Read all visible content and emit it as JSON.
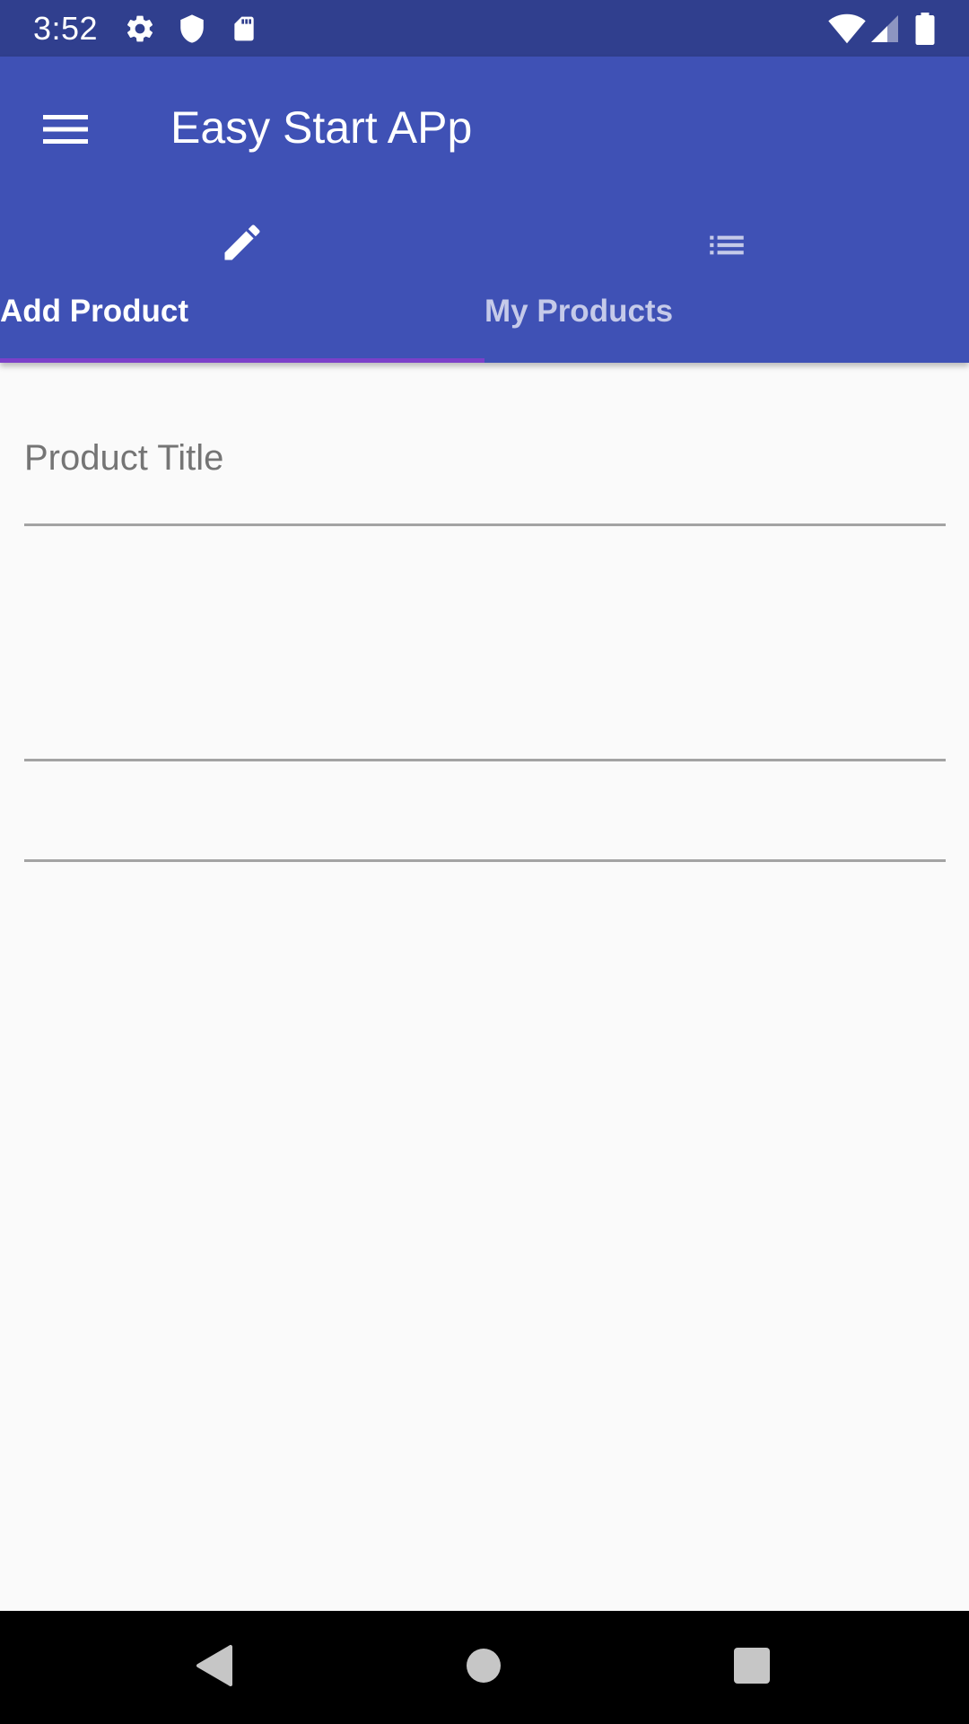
{
  "status_bar": {
    "time": "3:52",
    "left_icons": [
      "settings-icon",
      "shield-icon",
      "sd-card-icon"
    ],
    "right_icons": [
      "wifi-icon",
      "signal-icon",
      "battery-icon"
    ]
  },
  "app_bar": {
    "title": "Easy Start APp",
    "menu_icon": "menu-icon"
  },
  "tabs": [
    {
      "label": "Add Product",
      "icon": "pencil-icon",
      "selected": true
    },
    {
      "label": "My Products",
      "icon": "list-icon",
      "selected": false
    }
  ],
  "form": {
    "product_title_hint": "Product Title",
    "product_title_value": "",
    "description_value": "",
    "price_value": ""
  },
  "nav_bar": {
    "buttons": [
      "back-icon",
      "home-icon",
      "recents-icon"
    ]
  },
  "colors": {
    "primary": "#3f51b5",
    "primary_dark": "#303f8e",
    "tab_indicator": "#7b40c9",
    "tab_unselected_text": "#c5cae9",
    "background": "#fafafa",
    "hint_text": "#757575",
    "divider": "#a3a3a3"
  }
}
